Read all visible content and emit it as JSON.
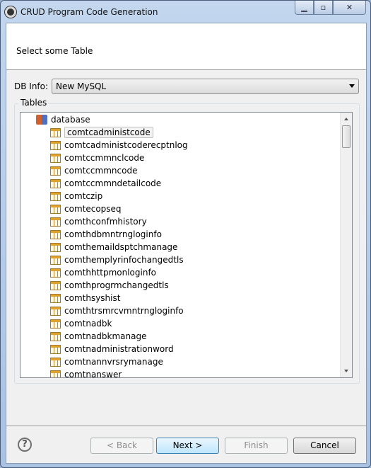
{
  "window": {
    "title": "CRUD Program Code Generation",
    "controls": [
      "minimize",
      "maximize",
      "close"
    ]
  },
  "header": {
    "message": "Select some Table"
  },
  "db_info": {
    "label": "DB Info:",
    "value": "New MySQL"
  },
  "tables": {
    "label": "Tables",
    "root": "database",
    "selected": "comtcadministcode",
    "items": [
      "comtcadministcode",
      "comtcadministcoderecptnlog",
      "comtccmmnclcode",
      "comtccmmncode",
      "comtccmmndetailcode",
      "comtczip",
      "comtecopseq",
      "comthconfmhistory",
      "comthdbmntrngloginfo",
      "comthemaildsptchmanage",
      "comthemplyrinfochangedtls",
      "comthhttpmonloginfo",
      "comthprogrmchangedtls",
      "comthsyshist",
      "comthtrsmrcvmntrngloginfo",
      "comtnadbk",
      "comtnadbkmanage",
      "comtnadministrationword",
      "comtnannvrsrymanage",
      "comtnanswer"
    ]
  },
  "buttons": {
    "back": "< Back",
    "next": "Next >",
    "finish": "Finish",
    "cancel": "Cancel",
    "help": "?"
  }
}
